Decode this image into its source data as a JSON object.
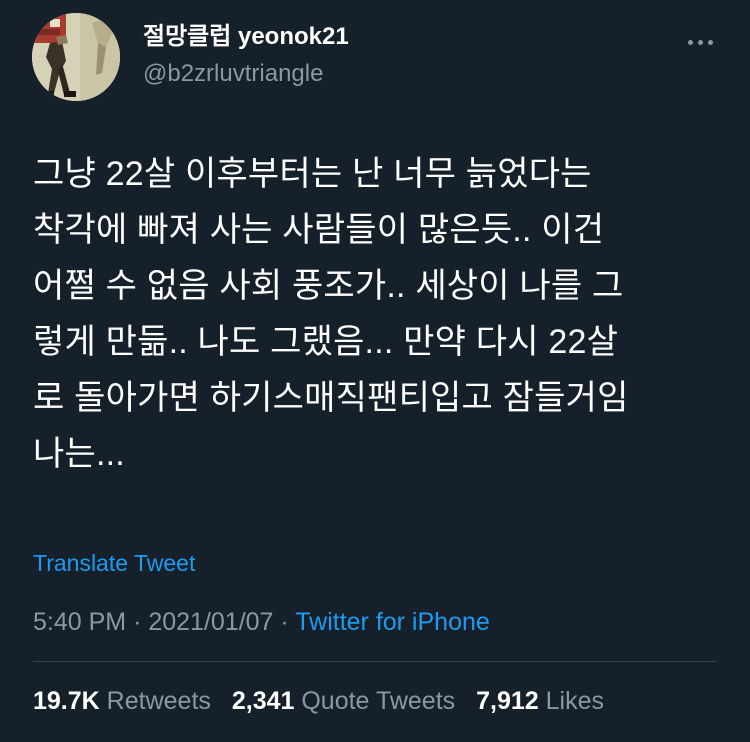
{
  "author": {
    "display_name": "절망클럽 yeonok21",
    "handle": "@b2zrluvtriangle"
  },
  "more_icon": "more-horizontal-icon",
  "tweet": {
    "text": "그냥 22살 이후부터는 난 너무 늙었다는\n착각에 빠져 사는 사람들이 많은듯.. 이건\n어쩔 수 없음 사회 풍조가.. 세상이 나를 그\n렇게 만듦.. 나도 그랬음... 만약 다시 22살\n로 돌아가면 하기스매직팬티입고 잠들거임\n나는...",
    "translate_label": "Translate Tweet",
    "time": "5:40 PM",
    "separator": "·",
    "date": "2021/01/07",
    "source": "Twitter for iPhone"
  },
  "stats": {
    "retweets_count": "19.7K",
    "retweets_label": "Retweets",
    "quote_count": "2,341",
    "quote_label": "Quote Tweets",
    "likes_count": "7,912",
    "likes_label": "Likes"
  },
  "colors": {
    "background": "#15202b",
    "text": "#ffffff",
    "secondary": "#8899a6",
    "link": "#1d9bf0",
    "divider": "#38444d"
  }
}
